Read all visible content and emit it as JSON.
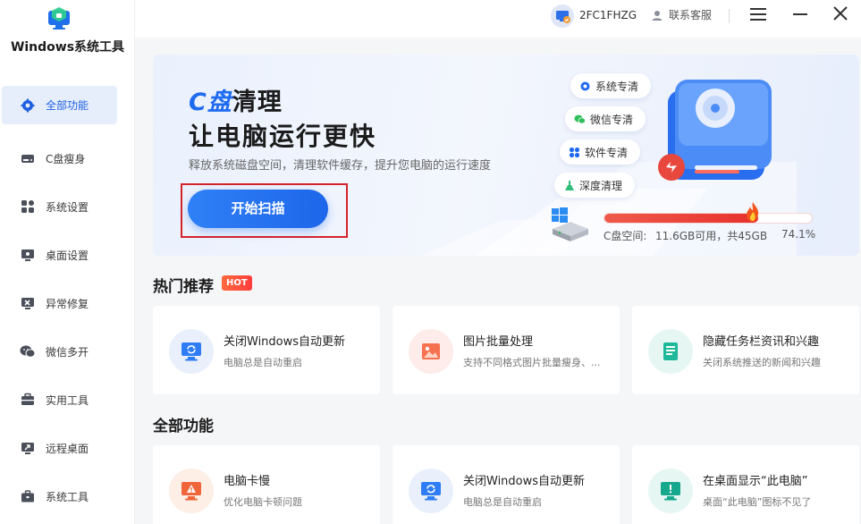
{
  "app": {
    "title": "Windows系统工具"
  },
  "sidebar": {
    "items": [
      {
        "label": "全部功能",
        "icon": "gear-icon",
        "active": true
      },
      {
        "label": "C盘瘦身",
        "icon": "drive-icon"
      },
      {
        "label": "系统设置",
        "icon": "grid-icon"
      },
      {
        "label": "桌面设置",
        "icon": "monitor-icon"
      },
      {
        "label": "异常修复",
        "icon": "repair-icon"
      },
      {
        "label": "微信多开",
        "icon": "wechat-icon"
      },
      {
        "label": "实用工具",
        "icon": "toolbox-icon"
      },
      {
        "label": "远程桌面",
        "icon": "remote-desktop-icon"
      },
      {
        "label": "系统工具",
        "icon": "briefcase-icon"
      }
    ]
  },
  "topbar": {
    "user_id": "2FC1FHZG",
    "support_label": "联系客服"
  },
  "hero": {
    "title_accent": "C盘",
    "title_rest": "清理",
    "title_line2": "让电脑运行更快",
    "description": "释放系统磁盘空间，清理软件缓存，提升您电脑的运行速度",
    "scan_button": "开始扫描",
    "pills": [
      "系统专清",
      "微信专清",
      "软件专清",
      "深度清理"
    ],
    "c_space_label": "C盘空间:",
    "c_space_used": "11.6GB可用，共45GB",
    "c_space_percent": "74.1%",
    "c_space_fraction": 0.741
  },
  "hot": {
    "heading": "热门推荐",
    "badge": "HOT",
    "cards": [
      {
        "title": "关闭Windows自动更新",
        "desc": "电脑总是自动重启",
        "icon": "refresh-monitor-icon"
      },
      {
        "title": "图片批量处理",
        "desc": "支持不同格式图片批量瘦身、...",
        "icon": "image-icon"
      },
      {
        "title": "隐藏任务栏资讯和兴趣",
        "desc": "关闭系统推送的新闻和兴趣",
        "icon": "news-icon"
      }
    ]
  },
  "all": {
    "heading": "全部功能",
    "cards": [
      {
        "title": "电脑卡慢",
        "desc": "优化电脑卡顿问题",
        "icon": "warning-monitor-icon"
      },
      {
        "title": "关闭Windows自动更新",
        "desc": "电脑总是自动重启",
        "icon": "refresh-monitor-icon"
      },
      {
        "title": "在桌面显示“此电脑”",
        "desc": "桌面“此电脑”图标不见了",
        "icon": "alert-monitor-icon"
      }
    ]
  },
  "colors": {
    "accent": "#1f6bf0",
    "danger": "#e7302b",
    "highlight_box": "#d6222a"
  }
}
